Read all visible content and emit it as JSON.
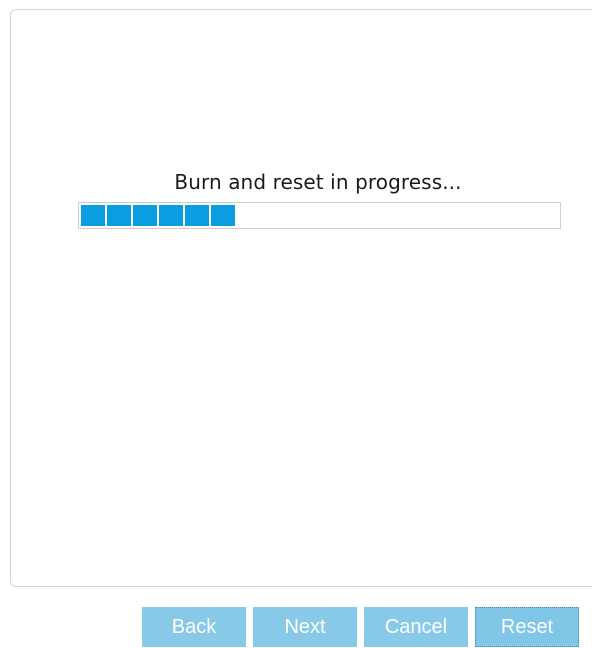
{
  "wizard": {
    "status_text": "Burn and reset in progress...",
    "progress": {
      "percent": 31,
      "visible_blocks": 6,
      "fill_color": "#0a9de0",
      "track_color": "#ffffff"
    }
  },
  "footer": {
    "buttons": {
      "back": "Back",
      "next": "Next",
      "cancel": "Cancel",
      "reset": "Reset"
    },
    "button_color": "#88c9e8",
    "focused_button": "Reset"
  }
}
